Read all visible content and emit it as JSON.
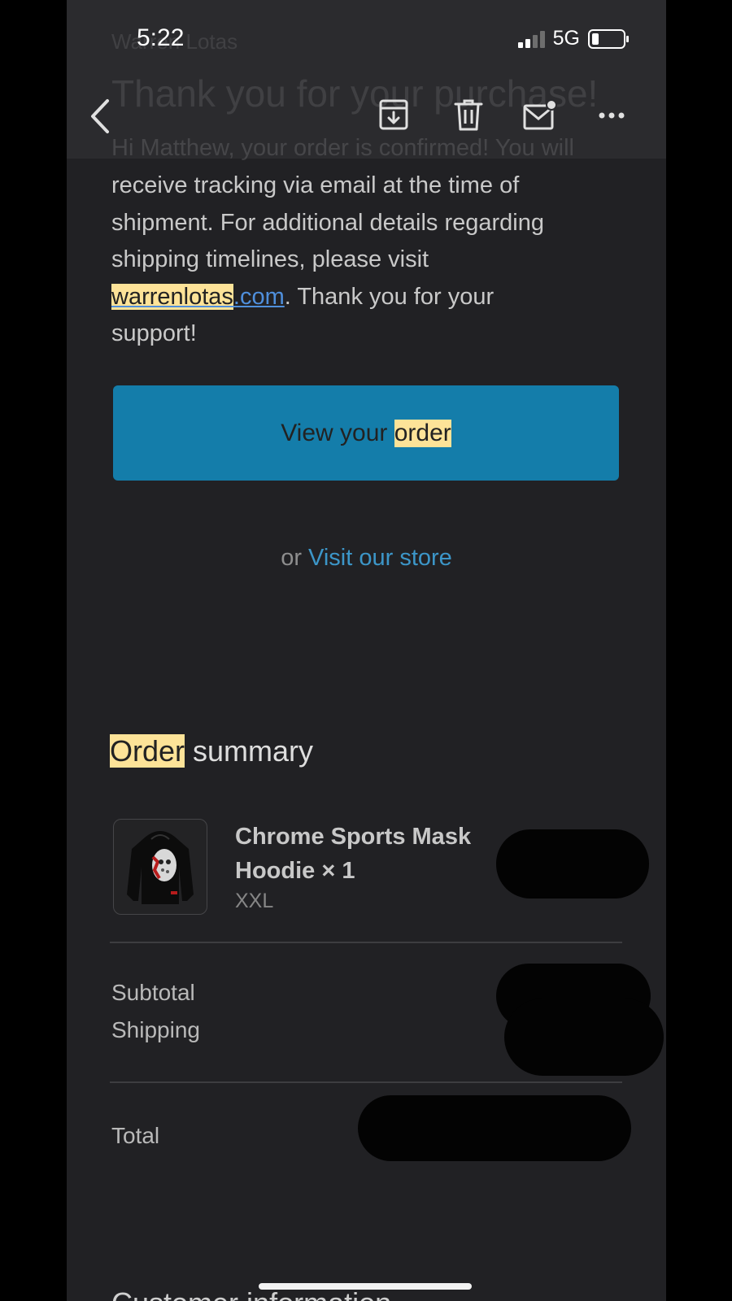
{
  "status_bar": {
    "time": "5:22",
    "network": "5G"
  },
  "header": {
    "ghost_sender": "Warren Lotas",
    "ghost_title": "Thank you for your purchase!",
    "ghost_first_line": "Hi Matthew, your order is confirmed! You will"
  },
  "message": {
    "line_1": "receive tracking via email at the time of",
    "line_2": "shipment. For additional details regarding",
    "line_3": "shipping timelines, please visit",
    "link_highlight": "warrenlotas",
    "link_rest": ".com",
    "line_4_rest": ". Thank you for your",
    "line_5": "support!"
  },
  "cta": {
    "prefix": "View your ",
    "highlight": "order",
    "or_text": "or",
    "store_link": "Visit our store"
  },
  "order_summary": {
    "title_highlight": "Order",
    "title_rest": " summary",
    "item": {
      "name_line1": "Chrome Sports Mask",
      "name_line2": "Hoodie × 1",
      "variant": "XXL"
    },
    "subtotal_label": "Subtotal",
    "shipping_label": "Shipping",
    "total_label": "Total"
  },
  "footer_partial": "Customer information",
  "colors": {
    "background": "#212124",
    "highlight": "#fde398",
    "button": "#147daa",
    "link": "#3c96c8"
  },
  "icons": [
    "back-chevron-icon",
    "archive-icon",
    "trash-icon",
    "mark-unread-icon",
    "more-icon"
  ]
}
